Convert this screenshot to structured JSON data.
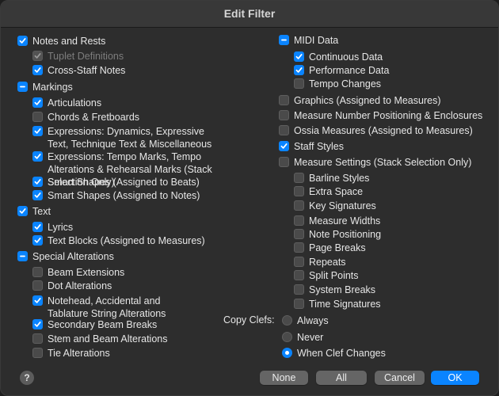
{
  "dialog": {
    "title": "Edit Filter"
  },
  "left_items": [
    {
      "label": "Notes and Rests",
      "state": "checked"
    },
    {
      "label": "Tuplet Definitions",
      "state": "checked-disabled"
    },
    {
      "label": "Cross-Staff Notes",
      "state": "checked"
    },
    {
      "label": "Markings",
      "state": "mixed"
    },
    {
      "label": "Articulations",
      "state": "checked"
    },
    {
      "label": "Chords & Fretboards",
      "state": "unchecked"
    },
    {
      "label": "Expressions: Dynamics, Expressive Text, Technique Text & Miscellaneous",
      "state": "checked"
    },
    {
      "label": "Expressions: Tempo Marks, Tempo Alterations & Rehearsal Marks (Stack Selection Only)",
      "state": "checked"
    },
    {
      "label": "Smart Shapes (Assigned to Beats)",
      "state": "checked"
    },
    {
      "label": "Smart Shapes (Assigned to Notes)",
      "state": "checked"
    },
    {
      "label": "Text",
      "state": "checked"
    },
    {
      "label": "Lyrics",
      "state": "checked"
    },
    {
      "label": "Text Blocks (Assigned to Measures)",
      "state": "checked"
    },
    {
      "label": "Special Alterations",
      "state": "mixed"
    },
    {
      "label": "Beam Extensions",
      "state": "unchecked"
    },
    {
      "label": "Dot Alterations",
      "state": "unchecked"
    },
    {
      "label": "Notehead, Accidental and Tablature String Alterations",
      "state": "checked"
    },
    {
      "label": "Secondary Beam Breaks",
      "state": "checked"
    },
    {
      "label": "Stem and Beam Alterations",
      "state": "unchecked"
    },
    {
      "label": "Tie Alterations",
      "state": "unchecked"
    }
  ],
  "right_items": [
    {
      "label": "MIDI Data",
      "state": "mixed"
    },
    {
      "label": "Continuous Data",
      "state": "checked"
    },
    {
      "label": "Performance Data",
      "state": "checked"
    },
    {
      "label": "Tempo Changes",
      "state": "unchecked"
    },
    {
      "label": "Graphics (Assigned to Measures)",
      "state": "unchecked"
    },
    {
      "label": "Measure Number Positioning & Enclosures",
      "state": "unchecked"
    },
    {
      "label": "Ossia Measures (Assigned to Measures)",
      "state": "unchecked"
    },
    {
      "label": "Staff Styles",
      "state": "checked"
    },
    {
      "label": "Measure Settings (Stack Selection Only)",
      "state": "unchecked"
    },
    {
      "label": "Barline Styles",
      "state": "unchecked"
    },
    {
      "label": "Extra Space",
      "state": "unchecked"
    },
    {
      "label": "Key Signatures",
      "state": "unchecked"
    },
    {
      "label": "Measure Widths",
      "state": "unchecked"
    },
    {
      "label": "Note Positioning",
      "state": "unchecked"
    },
    {
      "label": "Page Breaks",
      "state": "unchecked"
    },
    {
      "label": "Repeats",
      "state": "unchecked"
    },
    {
      "label": "Split Points",
      "state": "unchecked"
    },
    {
      "label": "System Breaks",
      "state": "unchecked"
    },
    {
      "label": "Time Signatures",
      "state": "unchecked"
    }
  ],
  "copy_clefs": {
    "label": "Copy Clefs:",
    "options": [
      {
        "label": "Always",
        "selected": false
      },
      {
        "label": "Never",
        "selected": false
      },
      {
        "label": "When Clef Changes",
        "selected": true
      }
    ]
  },
  "buttons": {
    "help": "?",
    "none": "None",
    "all": "All",
    "cancel": "Cancel",
    "ok": "OK"
  },
  "colors": {
    "accent": "#0a84ff",
    "dialog_bg": "#2d2d2d",
    "titlebar_bg": "#383838"
  }
}
